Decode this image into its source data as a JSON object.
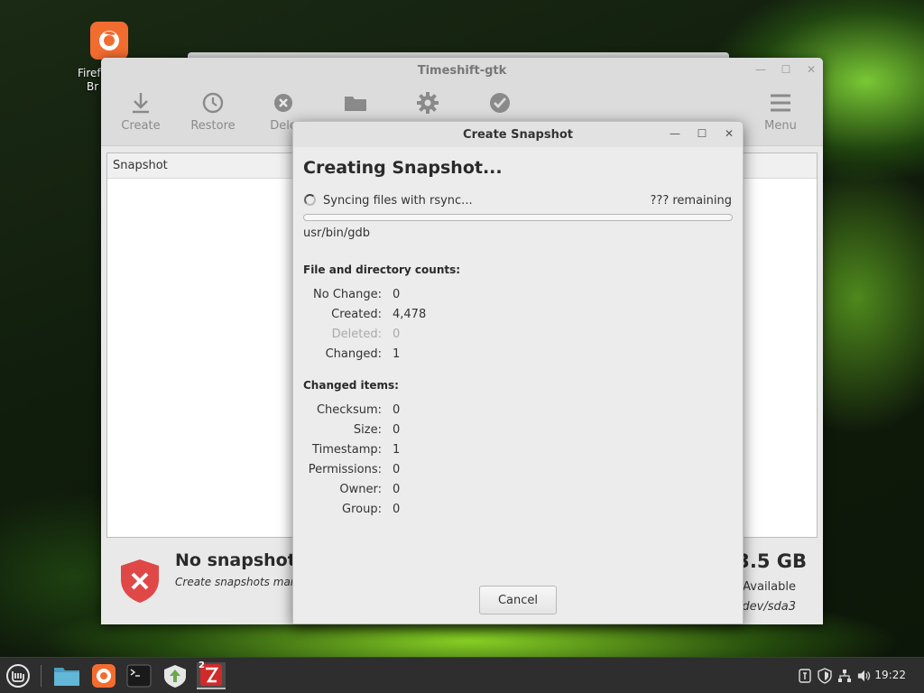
{
  "desktop": {
    "icon_label_lines": [
      "Firef",
      "Br"
    ]
  },
  "main_window": {
    "title": "Timeshift-gtk",
    "toolbar": [
      {
        "label": "Create",
        "icon": "download-icon"
      },
      {
        "label": "Restore",
        "icon": "clock-icon"
      },
      {
        "label": "Dele",
        "icon": "delete-icon"
      },
      {
        "label": "",
        "icon": "folder-icon"
      },
      {
        "label": "",
        "icon": "gear-icon"
      },
      {
        "label": "",
        "icon": "check-icon"
      },
      {
        "label": "Menu",
        "icon": "hamburger-icon"
      }
    ],
    "column_header": "Snapshot",
    "status": {
      "title": "No snapshots",
      "subtitle": "Create snapshots manu",
      "disk_size": "3.5 GB",
      "available": "Available",
      "device": "/dev/sda3"
    }
  },
  "dialog": {
    "title": "Create Snapshot",
    "heading": "Creating Snapshot...",
    "sync_label": "Syncing files with rsync...",
    "remaining": "??? remaining",
    "progress": 0.0,
    "current_file": "usr/bin/gdb",
    "counts_title": "File and directory counts:",
    "counts": [
      {
        "label": "No Change:",
        "value": "0"
      },
      {
        "label": "Created:",
        "value": "4,478"
      },
      {
        "label": "Deleted:",
        "value": "0",
        "dim": true
      },
      {
        "label": "Changed:",
        "value": "1"
      }
    ],
    "changed_title": "Changed items:",
    "changed": [
      {
        "label": "Checksum:",
        "value": "0"
      },
      {
        "label": "Size:",
        "value": "0"
      },
      {
        "label": "Timestamp:",
        "value": "1"
      },
      {
        "label": "Permissions:",
        "value": "0"
      },
      {
        "label": "Owner:",
        "value": "0"
      },
      {
        "label": "Group:",
        "value": "0"
      }
    ],
    "cancel_label": "Cancel"
  },
  "taskbar": {
    "apps": [
      "mint-menu-icon",
      "files-icon",
      "firefox-icon",
      "terminal-icon",
      "update-manager-icon",
      "timeshift-icon"
    ],
    "timeshift_badge": "2",
    "tray": [
      "keyboard-indicator-icon",
      "shield-tray-icon",
      "network-icon",
      "volume-icon"
    ],
    "clock": "19:22"
  },
  "colors": {
    "firefox_orange": "#f26c30",
    "error_red": "#e04848",
    "taskbar": "#2e2e2e"
  }
}
